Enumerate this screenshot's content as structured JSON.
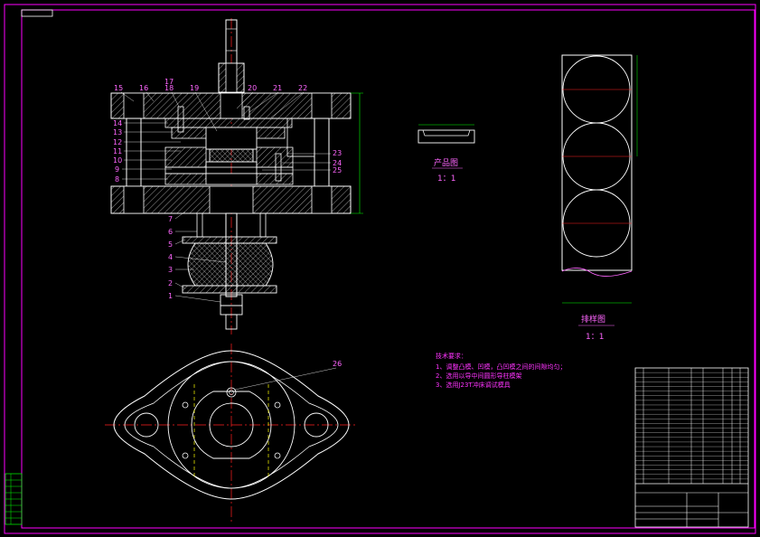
{
  "drawing": {
    "part_labels": [
      "1",
      "2",
      "3",
      "4",
      "5",
      "6",
      "7",
      "8",
      "9",
      "10",
      "11",
      "12",
      "13",
      "14",
      "15",
      "16",
      "17",
      "18",
      "19",
      "20",
      "21",
      "22",
      "23",
      "24",
      "25"
    ],
    "product_caption": "产品图",
    "product_scale": "1：1",
    "layout_caption": "排样图",
    "layout_scale": "1：1",
    "dim_26": "26",
    "tech_req_title": "技术要求：",
    "tech_req_items": [
      "1、调整凸模、凹模，凸凹模之间的间隙均匀；",
      "2、选用以导中间圆形导柱模架",
      "3、选用J23T冲床调试模具"
    ]
  },
  "colors": {
    "frame": "#ff00ff",
    "outline": "#ffffff",
    "centerline": "#ff2020",
    "hatch": "#ffffff",
    "dim": "#00ff00",
    "text": "#ff66ff",
    "table": "#ffffff"
  }
}
